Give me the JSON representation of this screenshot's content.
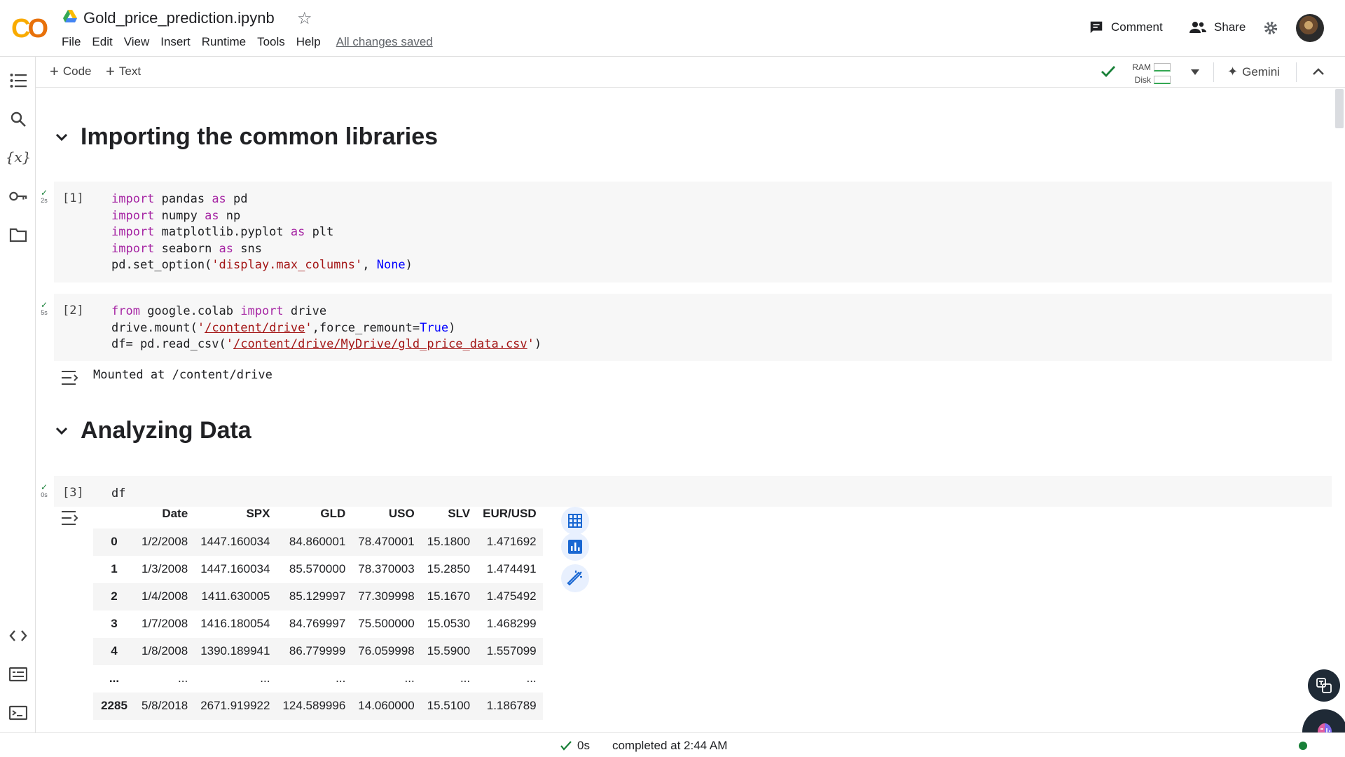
{
  "header": {
    "title": "Gold_price_prediction.ipynb",
    "menu": [
      "File",
      "Edit",
      "View",
      "Insert",
      "Runtime",
      "Tools",
      "Help"
    ],
    "saved_status": "All changes saved",
    "comment_label": "Comment",
    "share_label": "Share"
  },
  "toolbar": {
    "add_code": "Code",
    "add_text": "Text",
    "ram_label": "RAM",
    "disk_label": "Disk",
    "gemini_label": "Gemini"
  },
  "sections": {
    "s1": "Importing the common libraries",
    "s2": "Analyzing Data"
  },
  "cells": {
    "c1": {
      "prompt": "[1]",
      "time": "2s"
    },
    "c2": {
      "prompt": "[2]",
      "time": "5s",
      "output": "Mounted at /content/drive"
    },
    "c3": {
      "prompt": "[3]",
      "time": "0s",
      "code": "df"
    }
  },
  "dataframe": {
    "columns": [
      "",
      "Date",
      "SPX",
      "GLD",
      "USO",
      "SLV",
      "EUR/USD"
    ],
    "rows": [
      [
        "0",
        "1/2/2008",
        "1447.160034",
        "84.860001",
        "78.470001",
        "15.1800",
        "1.471692"
      ],
      [
        "1",
        "1/3/2008",
        "1447.160034",
        "85.570000",
        "78.370003",
        "15.2850",
        "1.474491"
      ],
      [
        "2",
        "1/4/2008",
        "1411.630005",
        "85.129997",
        "77.309998",
        "15.1670",
        "1.475492"
      ],
      [
        "3",
        "1/7/2008",
        "1416.180054",
        "84.769997",
        "75.500000",
        "15.0530",
        "1.468299"
      ],
      [
        "4",
        "1/8/2008",
        "1390.189941",
        "86.779999",
        "76.059998",
        "15.5900",
        "1.557099"
      ],
      [
        "...",
        "...",
        "...",
        "...",
        "...",
        "...",
        "..."
      ],
      [
        "2285",
        "5/8/2018",
        "2671.919922",
        "124.589996",
        "14.060000",
        "15.5100",
        "1.186789"
      ]
    ]
  },
  "status": {
    "duration": "0s",
    "completed": "completed at 2:44 AM"
  },
  "colors": {
    "keyword": "#a626a4",
    "string": "#a31515",
    "constant": "#0000ff",
    "success": "#188038",
    "logo_orange": "#f9ab00"
  }
}
